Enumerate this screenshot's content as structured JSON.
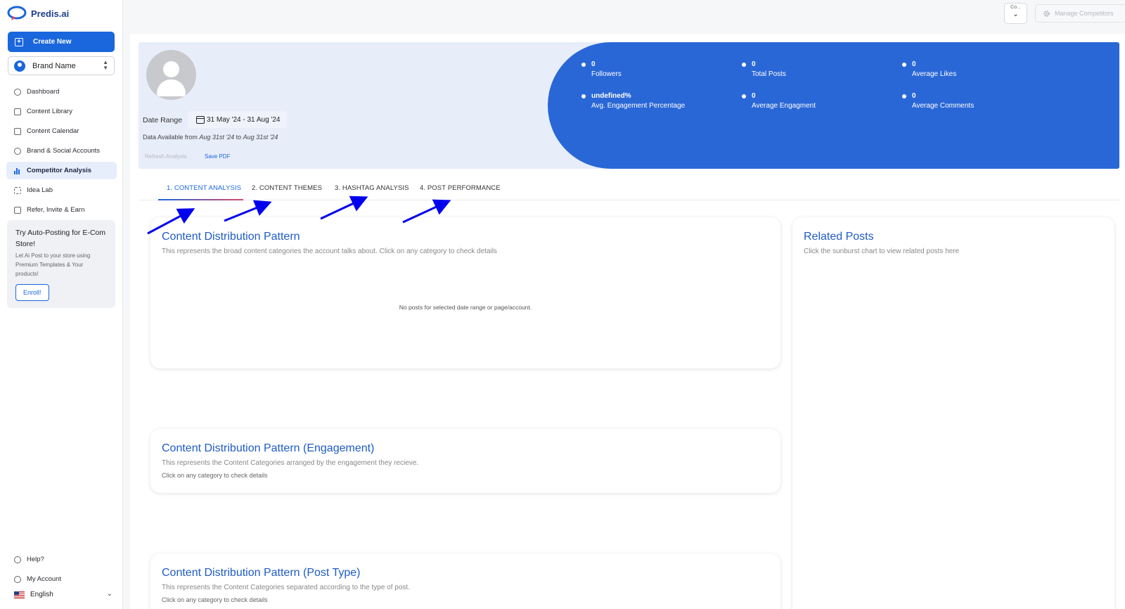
{
  "app": {
    "logo_text": "Predis.ai"
  },
  "sidebar": {
    "create_label": "Create New",
    "brand_label": "Brand Name",
    "items": [
      {
        "label": "Dashboard",
        "icon": "home-icon"
      },
      {
        "label": "Content Library",
        "icon": "library-icon"
      },
      {
        "label": "Content Calendar",
        "icon": "calendar-icon"
      },
      {
        "label": "Brand & Social Accounts",
        "icon": "brand-icon"
      },
      {
        "label": "Competitor Analysis",
        "icon": "bar-chart-icon",
        "active": true
      },
      {
        "label": "Idea Lab",
        "icon": "idea-icon"
      },
      {
        "label": "Refer, Invite & Earn",
        "icon": "gift-icon"
      }
    ],
    "promo": {
      "title": "Try Auto-Posting for E-Com Store!",
      "text": "Let Ai Post to your store using Premium Templates & Your products!",
      "button": "Enroll!"
    },
    "bottom": [
      {
        "label": "Help?",
        "icon": "help-icon"
      },
      {
        "label": "My Account",
        "icon": "account-icon"
      }
    ],
    "language": "English"
  },
  "topbar": {
    "competitor_select": "Co...",
    "manage_label": "Manage Competitors"
  },
  "hero": {
    "date_label": "Date Range",
    "date_value": "31 May '24 - 31 Aug '24",
    "avail_prefix": "Data Available from ",
    "avail_from": "Aug 31st '24",
    "avail_mid": " to ",
    "avail_to": "Aug 31st '24",
    "refresh_label": "Refresh Analysis",
    "save_label": "Save PDF",
    "stats": [
      {
        "value": "0",
        "label": "Followers"
      },
      {
        "value": "0",
        "label": "Total Posts"
      },
      {
        "value": "0",
        "label": "Average Likes"
      },
      {
        "value": "undefined%",
        "label": "Avg. Engagement Percentage"
      },
      {
        "value": "0",
        "label": "Average Engagment"
      },
      {
        "value": "0",
        "label": "Average Comments"
      }
    ]
  },
  "tabs": [
    "1. CONTENT ANALYSIS",
    "2. CONTENT THEMES",
    "3. HASHTAG ANALYSIS",
    "4. POST PERFORMANCE"
  ],
  "cards": {
    "distribution": {
      "title": "Content Distribution Pattern",
      "subtitle": "This represents the broad content categories the account talks about. Click on any category to check details",
      "empty": "No posts for selected date range or page/account."
    },
    "related": {
      "title": "Related Posts",
      "subtitle": "Click the sunburst chart to view related posts here"
    },
    "engagement": {
      "title": "Content Distribution Pattern (Engagement)",
      "subtitle": "This represents the Content Categories arranged by the engagement they recieve.",
      "hint": "Click on any category to check details"
    },
    "post_type": {
      "title": "Content Distribution Pattern (Post Type)",
      "subtitle": "This represents the Content Categories separated according to the type of post.",
      "hint": "Click on any category to check details"
    }
  },
  "colors": {
    "primary": "#1a66dc",
    "hero_bg": "#e7edf9",
    "stats_bg": "#2a67d6",
    "annotation_arrow": "#0000ee"
  }
}
